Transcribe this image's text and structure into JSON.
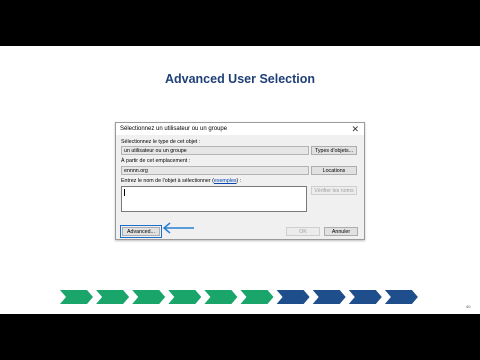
{
  "slide": {
    "title": "Advanced User Selection",
    "page_number": "40"
  },
  "dialog": {
    "title": "Sélectionnez un utilisateur ou un groupe",
    "close_glyph": "✕",
    "object_type_label": "Sélectionnez le type de cet objet :",
    "object_type_value": "un utilisateur ou un groupe",
    "object_types_button": "Types d'objets...",
    "location_label": "À partir de cet emplacement :",
    "location_value": "ennnn.org",
    "locations_button": "Locations",
    "enter_name_label": "Entrez le nom de l'objet à sélectionner (",
    "examples_link": "exemples",
    "enter_name_label_end": ") :",
    "check_names_button": "Vérifier les noms",
    "advanced_button": "Advanced...",
    "ok_button": "OK",
    "cancel_button": "Annuler"
  },
  "progress": {
    "total_steps": 10,
    "completed_steps": 6,
    "completed_color": "#1aa56a",
    "remaining_color": "#1f4e8c"
  }
}
